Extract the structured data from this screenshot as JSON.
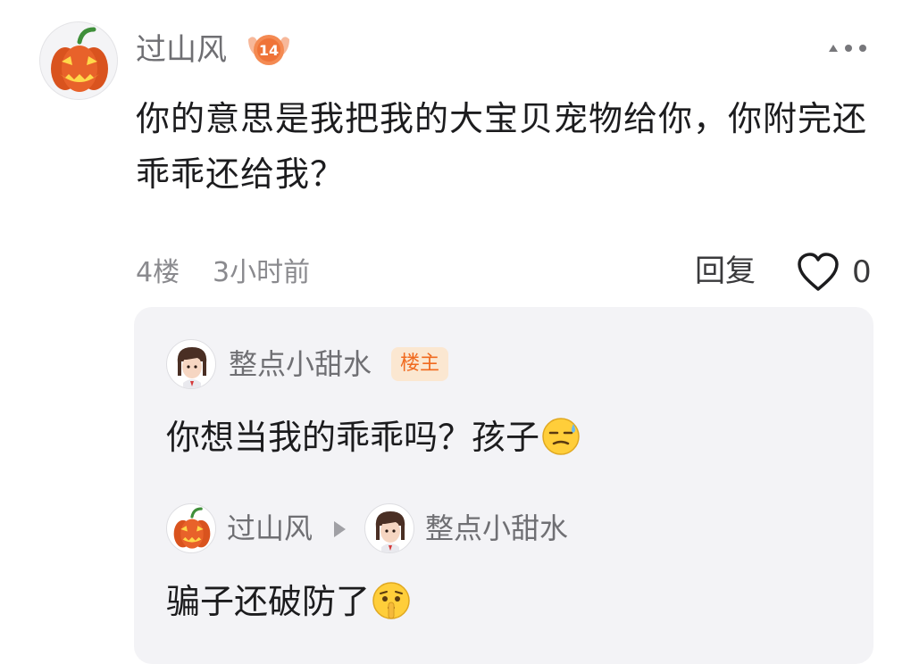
{
  "comment": {
    "author": "过山风",
    "level": "14",
    "text": "你的意思是我把我的大宝贝宠物给你，你附完还乖乖还给我？",
    "floor": "4楼",
    "time": "3小时前",
    "reply_label": "回复",
    "like_count": "0",
    "avatar_icon": "pumpkin-avatar",
    "more_icon": "more-options-icon"
  },
  "replies": [
    {
      "author": "整点小甜水",
      "badge": "楼主",
      "text": "你想当我的乖乖吗？孩子",
      "emoji": "sweat-face-emoji",
      "avatar_icon": "girl-avatar"
    },
    {
      "author": "过山风",
      "reply_to": "整点小甜水",
      "text": "骗子还破防了",
      "emoji": "shush-face-emoji",
      "avatar_icon": "pumpkin-avatar",
      "target_avatar_icon": "girl-avatar"
    }
  ],
  "colors": {
    "accent_orange": "#f06a1f",
    "owner_badge_bg": "#fbe7d1",
    "panel_bg": "#f3f3f6",
    "meta_gray": "#8a8a8e"
  }
}
